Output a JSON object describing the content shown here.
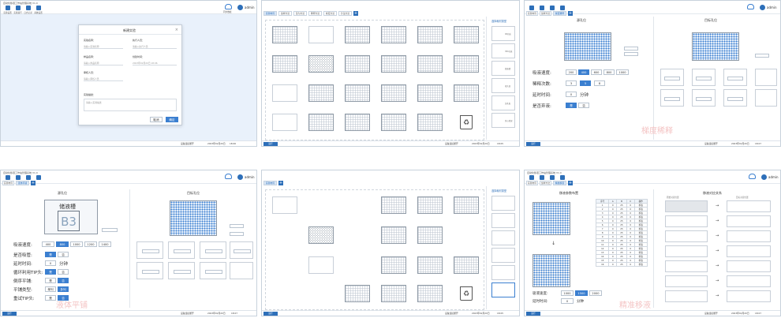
{
  "common": {
    "app_title": "自动化移液工作站管理系统 V1.0",
    "toolbar": [
      "实验设置",
      "实验运行",
      "日志记录",
      "系统设置"
    ],
    "cloud_label": "同步数据",
    "user": "admin",
    "run_button": "运行",
    "device_status": "设备连接断开",
    "date": "2023年02月20日",
    "time": "18:07"
  },
  "panel1": {
    "dialog_title": "新建实验",
    "fields": [
      {
        "label": "实验名称：",
        "value": "请输入实验名称"
      },
      {
        "label": "执行人员：",
        "value": "请输入执行人员"
      },
      {
        "label": "样品名称：",
        "value": "请输入样品名称"
      },
      {
        "label": "创建时间：",
        "value": "2023年02月20日 18:06"
      },
      {
        "label": "审核人员：",
        "value": "请输入审核人员"
      },
      {
        "label": "实验描述：",
        "value": "请输入实验描述"
      }
    ],
    "cancel": "取消",
    "confirm": "确定",
    "time": "18:06"
  },
  "panel2": {
    "tabs": [
      "实验布局",
      "加样方法",
      "混匀方法",
      "稀释方法",
      "梯度方法",
      "分注方法"
    ],
    "side_title": "选择耗材类型",
    "side_items": [
      "96孔板",
      "384孔板",
      "储液槽",
      "吸头盒",
      "深孔板",
      "离心管架"
    ],
    "card_label": "96孔板",
    "date": "2023年02月20日",
    "time": "18:05"
  },
  "panel3": {
    "tabs": [
      "实验布局",
      "加样方法",
      "梯度稀释"
    ],
    "left_title": "源孔位",
    "right_title": "目标孔位",
    "speed_label": "吸液速度:",
    "speed_values": [
      "200",
      "400",
      "600",
      "800",
      "1000"
    ],
    "count_label": "稀释次数:",
    "count_values": [
      "3",
      "5",
      "8"
    ],
    "delay_label": "延时时间:",
    "delay_value": "0",
    "delay_unit": "分钟",
    "tip_label": "是否弃液:",
    "tip_yes": "是",
    "tip_no": "否",
    "watermark": "梯度稀释",
    "time": "18:07"
  },
  "panel4": {
    "tabs": [
      "实验布局",
      "液体平铺"
    ],
    "left_title": "源孔位",
    "right_title": "目标孔位",
    "reservoir_label": "B3",
    "reservoir_title": "储液槽",
    "speed_label": "吸液速度:",
    "speed_values": [
      "400",
      "800",
      "1000",
      "1200",
      "1400"
    ],
    "rows": [
      {
        "label": "是否吸管:",
        "a": "是",
        "b": "否"
      },
      {
        "label": "延时时间:",
        "a": "0",
        "b": "分钟"
      },
      {
        "label": "循环利用TIP头:",
        "a": "是",
        "b": "否"
      },
      {
        "label": "倒序平铺:",
        "a": "是",
        "b": "否"
      },
      {
        "label": "平铺类型:",
        "a": "单列",
        "b": "多列"
      },
      {
        "label": "重试TIP头:",
        "a": "是",
        "b": "否"
      }
    ],
    "watermark": "液体平铺",
    "time": "18:07"
  },
  "panel5": {
    "tabs": [
      "实验布局"
    ],
    "side_title": "选择耗材类型",
    "date": "2023年02月20日",
    "time": "18:05"
  },
  "panel6": {
    "tabs": [
      "实验布局",
      "加样方法",
      "精准移液"
    ],
    "left_title": "移液参数布置",
    "right_title": "移液对应关系",
    "table_header": [
      "序号",
      "A",
      "B",
      "C",
      "操作"
    ],
    "table_rows": [
      [
        "0",
        "25",
        "0",
        "移液"
      ],
      [
        "0",
        "25",
        "0",
        "移液"
      ],
      [
        "0",
        "25",
        "0",
        "移液"
      ],
      [
        "0",
        "25",
        "0",
        "移液"
      ],
      [
        "0",
        "25",
        "0",
        "移液"
      ],
      [
        "0",
        "25",
        "0",
        "移液"
      ],
      [
        "0",
        "25",
        "0",
        "移液"
      ],
      [
        "0",
        "25",
        "0",
        "移液"
      ],
      [
        "0",
        "25",
        "0",
        "移液"
      ],
      [
        "0",
        "25",
        "0",
        "移液"
      ],
      [
        "0",
        "25",
        "0",
        "移液"
      ],
      [
        "0",
        "25",
        "0",
        "移液"
      ],
      [
        "0",
        "25",
        "0",
        "移液"
      ],
      [
        "0",
        "25",
        "0",
        "移液"
      ],
      [
        "0",
        "25",
        "0",
        "移液"
      ],
      [
        "0",
        "25",
        "0",
        "移液"
      ]
    ],
    "speed_label": "吸液速度:",
    "speed_values": [
      "1000",
      "1500",
      "2000"
    ],
    "delay_label": "延时时间:",
    "delay_value": "0",
    "delay_unit": "分钟",
    "mapping_source": "原始对应位置",
    "mapping_target": "目标对应位置",
    "watermark": "精准移液",
    "time": "18:07"
  }
}
